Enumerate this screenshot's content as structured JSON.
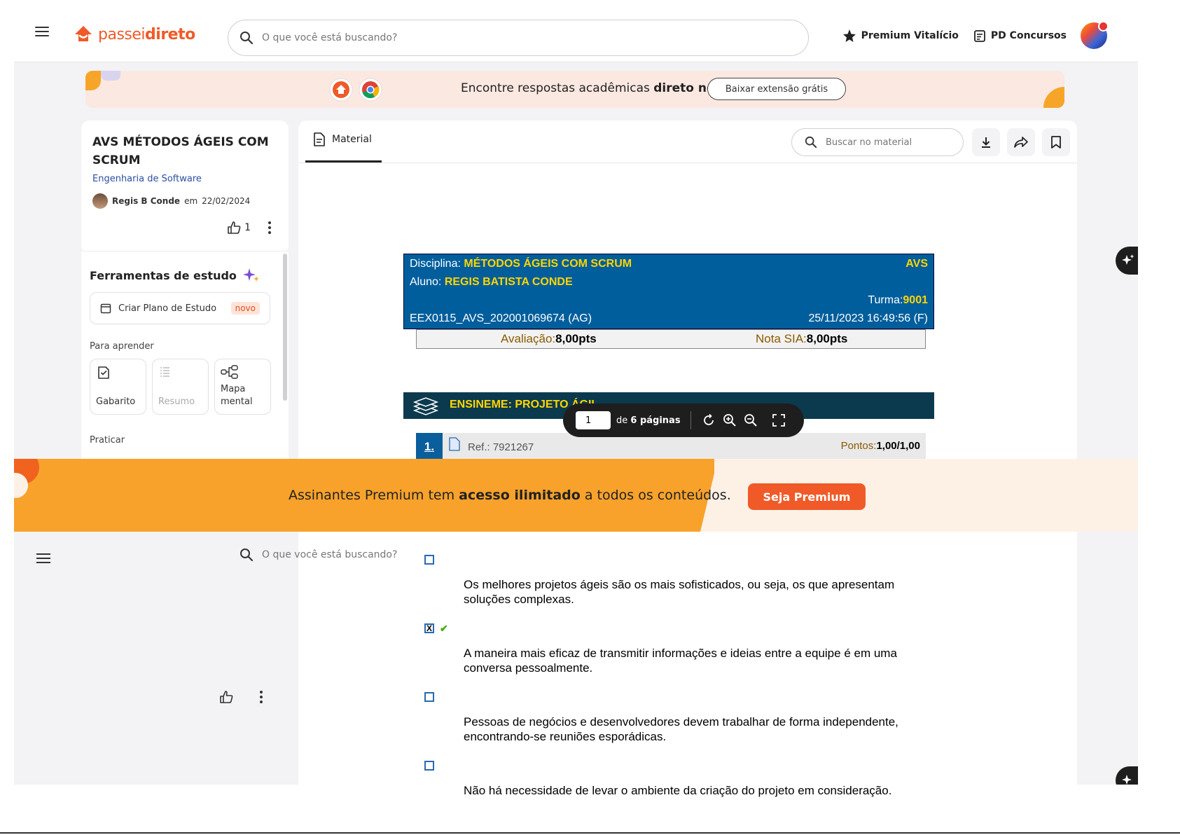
{
  "topbar": {
    "logo": {
      "text_light": "passei",
      "text_bold": "direto",
      "brand_color": "#f05a28"
    },
    "search_placeholder": "O que você está buscando?",
    "links": [
      {
        "label": "Premium Vitalício",
        "icon": "star-sparkle-icon"
      },
      {
        "label": "PD Concursos",
        "icon": "clipboard-list-icon"
      }
    ]
  },
  "extension_banner": {
    "text_prefix": "Encontre respostas acadêmicas ",
    "text_bold": "direto no Google!",
    "button": "Baixar extensão grátis"
  },
  "document": {
    "title": "AVS MÉTODOS ÁGEIS COM SCRUM",
    "subject": "Engenharia de Software",
    "author": "Regis B Conde",
    "date_prefix": "em",
    "date": "22/02/2024",
    "likes": "1"
  },
  "tools": {
    "title": "Ferramentas de estudo",
    "plan_button": "Criar Plano de Estudo",
    "plan_badge": "novo",
    "learn_label": "Para aprender",
    "learn_tiles": [
      {
        "label": "Gabarito",
        "icon": "clipboard-check-icon",
        "enabled": true
      },
      {
        "label": "Resumo",
        "icon": "list-icon",
        "enabled": false
      },
      {
        "label": "Mapa mental",
        "icon": "mind-map-icon",
        "enabled": true
      }
    ],
    "practice_label": "Praticar"
  },
  "viewer": {
    "tab": "Material",
    "search_placeholder": "Buscar no material",
    "actions": [
      "download-icon",
      "share-icon",
      "bookmark-icon"
    ]
  },
  "exam": {
    "discipline_label": "Disciplina:",
    "discipline": "MÉTODOS ÁGEIS COM SCRUM",
    "type": "AVS",
    "student_label": "Aluno:",
    "student": "REGIS BATISTA CONDE",
    "class_label": "Turma:",
    "class": "9001",
    "code": "EEX0115_AVS_202001069674 (AG)",
    "datetime": "25/11/2023 16:49:56 (F)",
    "eval_label": "Avaliação:",
    "eval_value": "8,00",
    "eval_unit": "pts",
    "sia_label": "Nota SIA:",
    "sia_value": "8,00",
    "sia_unit": "pts",
    "section": "ENSINEME: PROJETO ÁGIL",
    "question_number": "1.",
    "question_ref": "Ref.: 7921267",
    "points_label": "Pontos:",
    "points": "1,00/1,00",
    "answers": [
      {
        "text": "Os melhores projetos ágeis são os mais sofisticados, ou seja, os que apresentam soluções complexas.",
        "checked": false
      },
      {
        "text": "A maneira mais eficaz de transmitir informações e ideias entre a equipe é em uma conversa pessoalmente.",
        "checked": true
      },
      {
        "text": "Pessoas de negócios e desenvolvedores devem trabalhar de forma independente, encontrando-se reuniões esporádicas.",
        "checked": false
      },
      {
        "text": "Não há necessidade de levar o ambiente da criação do projeto em consideração.",
        "checked": false
      }
    ],
    "check_mark": "✔",
    "x_mark": "X"
  },
  "pager": {
    "page": "1",
    "of_text": "de",
    "total": "6 páginas"
  },
  "premium_banner": {
    "text_prefix": "Assinantes Premium tem ",
    "text_bold": "acesso ilimitado",
    "text_suffix": " a todos os conteúdos.",
    "button": "Seja Premium"
  },
  "colors": {
    "brand": "#f05a28",
    "exam_header": "#015e9c",
    "exam_highlight": "#ffd600",
    "premium_orange": "#f8a22b"
  }
}
